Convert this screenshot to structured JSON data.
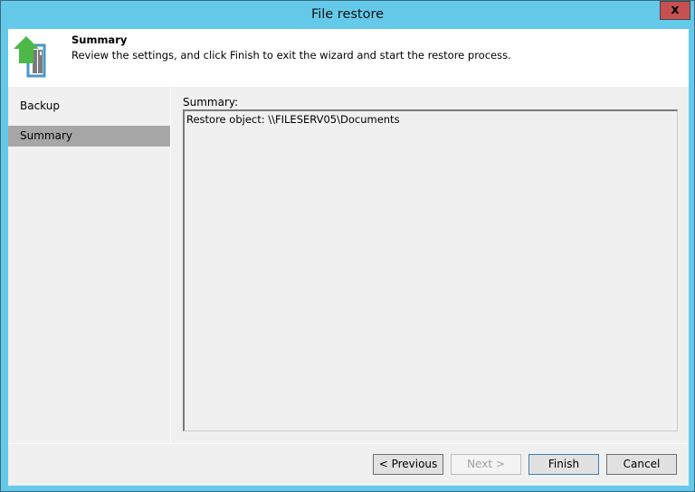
{
  "window": {
    "title": "File restore",
    "close": "x"
  },
  "header": {
    "title": "Summary",
    "description": "Review the settings, and click Finish to exit the wizard and start the restore process."
  },
  "nav": {
    "items": [
      {
        "label": "Backup",
        "selected": false
      },
      {
        "label": "Summary",
        "selected": true
      }
    ]
  },
  "main": {
    "summary_label": "Summary:",
    "summary_text": "Restore object: \\\\FILESERV05\\Documents"
  },
  "buttons": {
    "previous": "< Previous",
    "next": "Next >",
    "finish": "Finish",
    "cancel": "Cancel"
  }
}
